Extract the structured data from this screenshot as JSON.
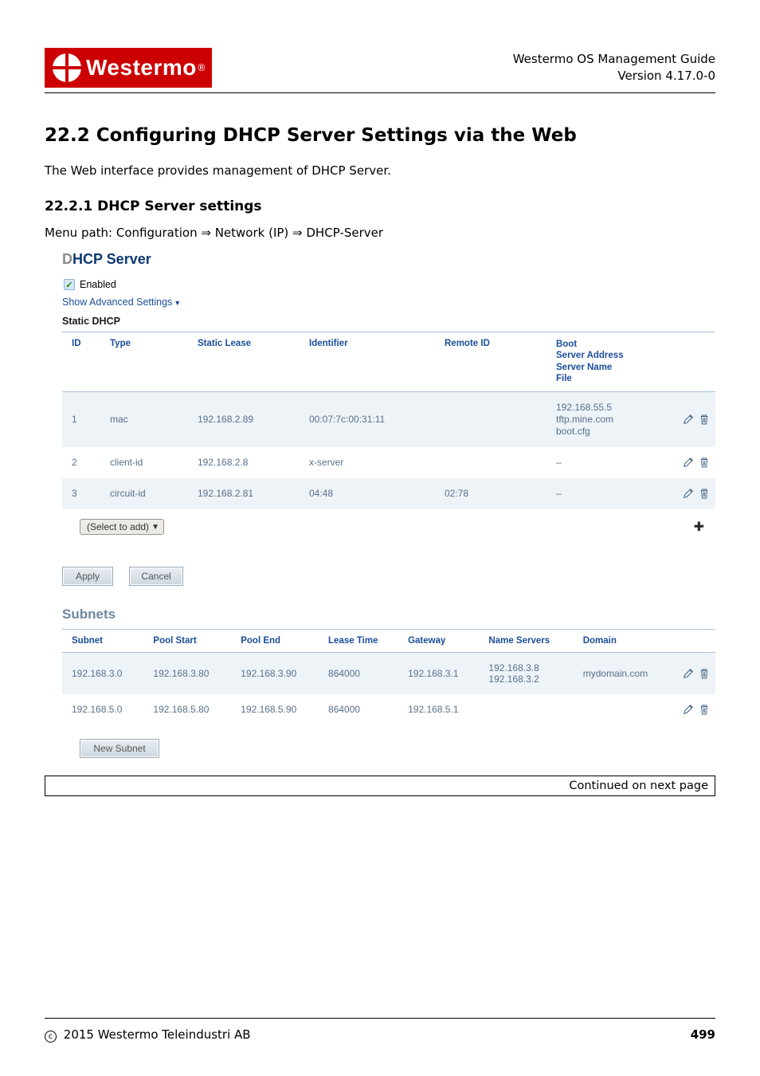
{
  "header": {
    "logo_text": "Westermo",
    "doc_title": "Westermo OS Management Guide",
    "doc_version": "Version 4.17.0-0"
  },
  "section": {
    "heading": "22.2   Configuring DHCP Server Settings via the Web",
    "intro": "The Web interface provides management of DHCP Server.",
    "sub_heading": "22.2.1   DHCP Server settings",
    "menu_path": "Menu path: Configuration ⇒ Network (IP) ⇒ DHCP-Server"
  },
  "dhcp": {
    "title_first": "D",
    "title_rest": "HCP Server",
    "enabled_label": "Enabled",
    "show_advanced": "Show Advanced Settings",
    "static_label": "Static DHCP",
    "headers": {
      "id": "ID",
      "type": "Type",
      "static_lease": "Static Lease",
      "identifier": "Identifier",
      "remote_id": "Remote ID",
      "boot": "Boot\nServer Address\nServer Name\nFile"
    },
    "rows": [
      {
        "id": "1",
        "type": "mac",
        "lease": "192.168.2.89",
        "identifier": "00:07:7c:00:31:11",
        "remote": "",
        "boot": "192.168.55.5\ntftp.mine.com\nboot.cfg",
        "striped": true
      },
      {
        "id": "2",
        "type": "client-id",
        "lease": "192.168.2.8",
        "identifier": "x-server",
        "remote": "",
        "boot": "–",
        "striped": false
      },
      {
        "id": "3",
        "type": "circuit-id",
        "lease": "192.168.2.81",
        "identifier": "04:48",
        "remote": "02:78",
        "boot": "–",
        "striped": true
      }
    ],
    "select_label": "(Select to add)",
    "apply": "Apply",
    "cancel": "Cancel"
  },
  "subnets": {
    "title": "Subnets",
    "headers": {
      "subnet": "Subnet",
      "pool_start": "Pool Start",
      "pool_end": "Pool End",
      "lease_time": "Lease Time",
      "gateway": "Gateway",
      "name_servers": "Name Servers",
      "domain": "Domain"
    },
    "rows": [
      {
        "subnet": "192.168.3.0",
        "start": "192.168.3.80",
        "end": "192.168.3.90",
        "lease": "864000",
        "gateway": "192.168.3.1",
        "ns": "192.168.3.8\n192.168.3.2",
        "domain": "mydomain.com",
        "striped": true
      },
      {
        "subnet": "192.168.5.0",
        "start": "192.168.5.80",
        "end": "192.168.5.90",
        "lease": "864000",
        "gateway": "192.168.5.1",
        "ns": "",
        "domain": "",
        "striped": false
      }
    ],
    "new_subnet": "New Subnet"
  },
  "continued": "Continued on next page",
  "footer": {
    "left": "2015 Westermo Teleindustri AB",
    "right": "499"
  }
}
